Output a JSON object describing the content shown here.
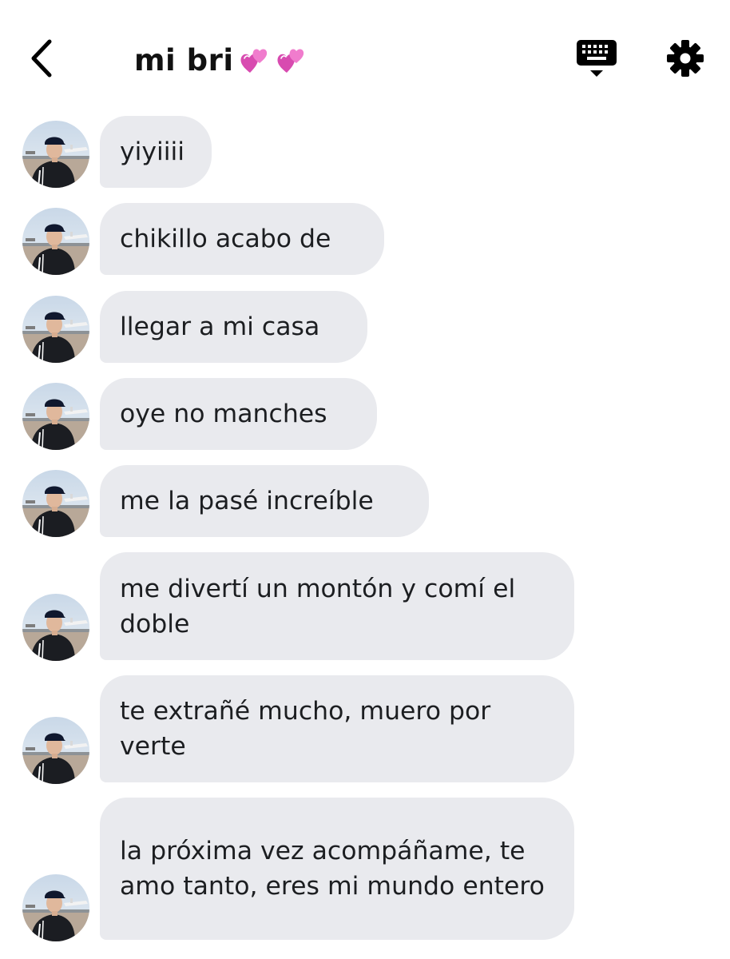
{
  "header": {
    "title": "mi bri",
    "title_emoji": [
      "revolving-hearts",
      "revolving-hearts"
    ]
  },
  "colors": {
    "bubble_bg": "#e9eaee",
    "text": "#1c1e21",
    "heart_pink": "#e85dbb"
  },
  "messages": [
    {
      "text": "yiyiiii"
    },
    {
      "text": "chikillo acabo de"
    },
    {
      "text": "llegar a mi casa"
    },
    {
      "text": "oye no manches"
    },
    {
      "text": "me la pasé increíble"
    },
    {
      "text": "me divertí un montón y comí el doble"
    },
    {
      "text": "te extrañé mucho, muero por verte"
    },
    {
      "text": "la próxima vez acompáñame, te amo tanto, eres mi mundo entero"
    }
  ]
}
